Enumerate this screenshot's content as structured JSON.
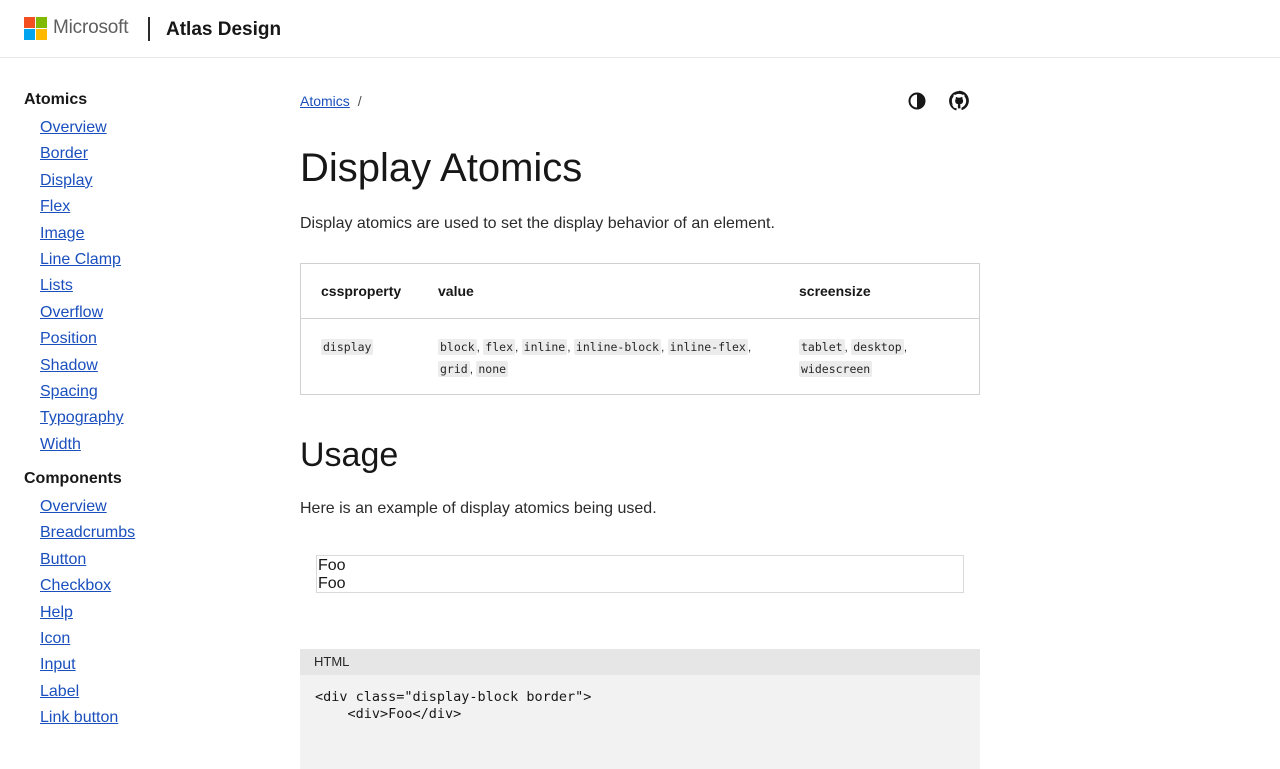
{
  "header": {
    "brand": "Microsoft",
    "site_title": "Atlas Design"
  },
  "sidebar": {
    "groups": [
      {
        "title": "Atomics",
        "items": [
          "Overview",
          "Border",
          "Display",
          "Flex",
          "Image",
          "Line Clamp",
          "Lists",
          "Overflow",
          "Position",
          "Shadow",
          "Spacing",
          "Typography",
          "Width"
        ]
      },
      {
        "title": "Components",
        "items": [
          "Overview",
          "Breadcrumbs",
          "Button",
          "Checkbox",
          "Help",
          "Icon",
          "Input",
          "Label",
          "Link button"
        ]
      }
    ]
  },
  "main": {
    "breadcrumb": {
      "link": "Atomics",
      "separator": "/"
    },
    "icons": [
      "theme-toggle-icon",
      "github-icon"
    ],
    "title": "Display Atomics",
    "description": "Display atomics are used to set the display behavior of an element.",
    "table": {
      "headers": [
        "cssproperty",
        "value",
        "screensize"
      ],
      "row": {
        "cssproperty": "display",
        "values": [
          "block",
          "flex",
          "inline",
          "inline-block",
          "inline-flex",
          "grid",
          "none"
        ],
        "screensizes": [
          "tablet",
          "desktop",
          "widescreen"
        ]
      }
    },
    "usage": {
      "title": "Usage",
      "description": "Here is an example of display atomics being used.",
      "demo_lines": [
        "Foo",
        "Foo"
      ]
    },
    "code": {
      "language": "HTML",
      "lines": [
        "<div class=\"display-block border\">",
        "    <div>Foo</div>"
      ]
    }
  }
}
